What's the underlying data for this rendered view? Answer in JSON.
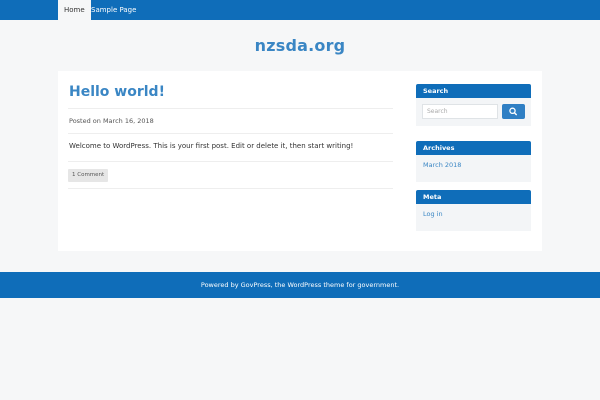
{
  "nav": {
    "items": [
      {
        "label": "Home",
        "active": true
      },
      {
        "label": "Sample Page",
        "active": false
      }
    ]
  },
  "site": {
    "title": "nzsda.org"
  },
  "post": {
    "title": "Hello world!",
    "meta": "Posted on March 16, 2018",
    "body": "Welcome to WordPress. This is your first post. Edit or delete it, then start writing!",
    "comment_label": "1 Comment"
  },
  "sidebar": {
    "search": {
      "heading": "Search",
      "placeholder": "Search",
      "button_icon": "search-icon"
    },
    "archives": {
      "heading": "Archives",
      "items": [
        "March 2018"
      ]
    },
    "meta": {
      "heading": "Meta",
      "items": [
        "Log in"
      ]
    }
  },
  "footer": {
    "text": "Powered by GovPress, the WordPress theme for government."
  },
  "colors": {
    "brand_blue": "#0f6db9",
    "title_blue": "#3a86c4",
    "page_bg": "#f6f7f8"
  }
}
